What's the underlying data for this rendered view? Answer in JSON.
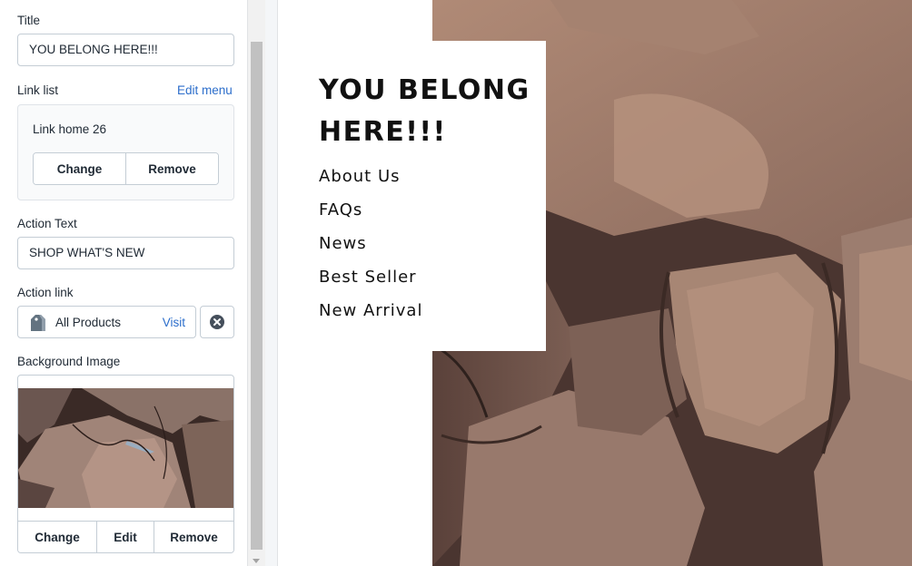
{
  "settings": {
    "title_label": "Title",
    "title_value": "YOU BELONG HERE!!!",
    "link_list_label": "Link list",
    "edit_menu": "Edit menu",
    "link_list_name": "Link home 26",
    "link_change": "Change",
    "link_remove": "Remove",
    "action_text_label": "Action Text",
    "action_text_value": "SHOP WHAT'S NEW",
    "action_link_label": "Action link",
    "action_link_value": "All Products",
    "visit": "Visit",
    "bg_label": "Background Image",
    "bg_change": "Change",
    "bg_edit": "Edit",
    "bg_remove": "Remove"
  },
  "preview": {
    "heading": "YOU BELONG HERE!!!",
    "menu": [
      "About Us",
      "FAQs",
      "News",
      "Best Seller",
      "New Arrival"
    ]
  },
  "colors": {
    "link": "#2c6ecb",
    "text": "#212b36",
    "border": "#c4cdd5"
  },
  "icons": {
    "tag": "tag-icon",
    "clear": "close-circle-icon"
  }
}
